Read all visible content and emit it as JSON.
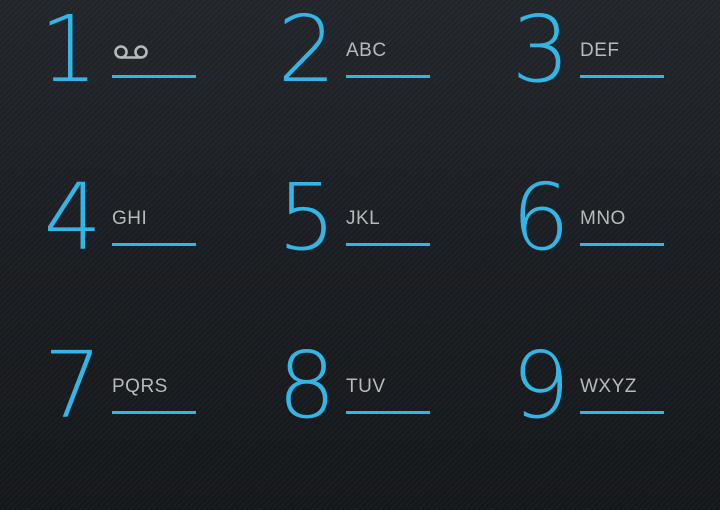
{
  "dialpad": {
    "accent_color": "#33b5e5",
    "label_color": "#b7babd",
    "keys": [
      {
        "digit": "1",
        "letters": "",
        "icon": "voicemail-icon"
      },
      {
        "digit": "2",
        "letters": "ABC"
      },
      {
        "digit": "3",
        "letters": "DEF"
      },
      {
        "digit": "4",
        "letters": "GHI"
      },
      {
        "digit": "5",
        "letters": "JKL"
      },
      {
        "digit": "6",
        "letters": "MNO"
      },
      {
        "digit": "7",
        "letters": "PQRS"
      },
      {
        "digit": "8",
        "letters": "TUV"
      },
      {
        "digit": "9",
        "letters": "WXYZ"
      }
    ]
  }
}
